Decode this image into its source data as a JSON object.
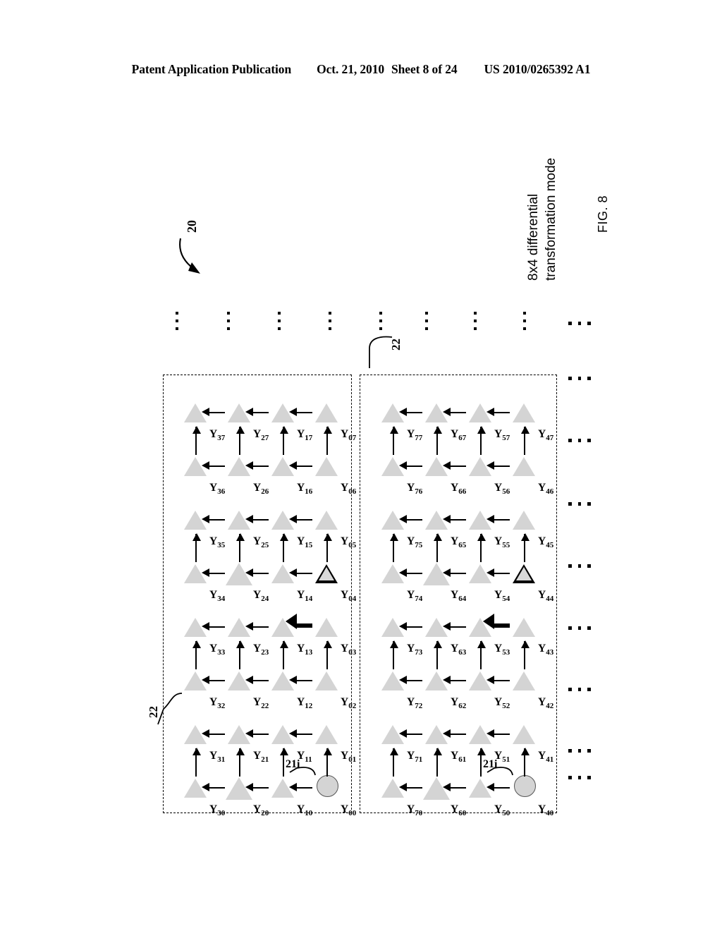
{
  "header": {
    "publication": "Patent Application Publication",
    "date": "Oct. 21, 2010",
    "sheet": "Sheet 8 of 24",
    "number": "US 2010/0265392 A1"
  },
  "figure": {
    "fig_caption": "FIG. 8",
    "mode_caption_line1": "8x4 differential",
    "mode_caption_line2": "transformation mode",
    "ref_20": "20",
    "ref_22_left": "22",
    "ref_22_right": "22",
    "ref_21i_left": "21i",
    "ref_21i_right": "21i",
    "ellipsis_horizontal": "...",
    "groups": [
      {
        "name": "left-group",
        "columns": [
          {
            "nodes": [
              {
                "label": "Y00",
                "sub": "00",
                "shape": "circle",
                "style": "gray"
              },
              {
                "label": "Y01",
                "sub": "01",
                "shape": "triangle",
                "style": "gray"
              },
              {
                "label": "Y02",
                "sub": "02",
                "shape": "triangle",
                "style": "gray"
              },
              {
                "label": "Y03",
                "sub": "03",
                "shape": "triangle",
                "style": "gray"
              },
              {
                "label": "Y04",
                "sub": "04",
                "shape": "triangle",
                "style": "outlined-bold"
              },
              {
                "label": "Y05",
                "sub": "05",
                "shape": "triangle",
                "style": "gray"
              },
              {
                "label": "Y06",
                "sub": "06",
                "shape": "triangle",
                "style": "gray"
              },
              {
                "label": "Y07",
                "sub": "07",
                "shape": "triangle",
                "style": "gray"
              }
            ]
          },
          {
            "nodes": [
              {
                "label": "Y10",
                "sub": "10",
                "shape": "triangle",
                "style": "gray"
              },
              {
                "label": "Y11",
                "sub": "11",
                "shape": "triangle",
                "style": "gray"
              },
              {
                "label": "Y12",
                "sub": "12",
                "shape": "triangle",
                "style": "gray"
              },
              {
                "label": "Y13",
                "sub": "13",
                "shape": "triangle",
                "style": "gray"
              },
              {
                "label": "Y14",
                "sub": "14",
                "shape": "triangle",
                "style": "gray"
              },
              {
                "label": "Y15",
                "sub": "15",
                "shape": "triangle",
                "style": "gray"
              },
              {
                "label": "Y16",
                "sub": "16",
                "shape": "triangle",
                "style": "gray"
              },
              {
                "label": "Y17",
                "sub": "17",
                "shape": "triangle",
                "style": "gray"
              }
            ]
          },
          {
            "nodes": [
              {
                "label": "Y20",
                "sub": "20",
                "shape": "triangle",
                "style": "gray-large"
              },
              {
                "label": "Y21",
                "sub": "21",
                "shape": "triangle",
                "style": "gray"
              },
              {
                "label": "Y22",
                "sub": "22",
                "shape": "triangle",
                "style": "gray"
              },
              {
                "label": "Y23",
                "sub": "23",
                "shape": "triangle",
                "style": "gray"
              },
              {
                "label": "Y24",
                "sub": "24",
                "shape": "triangle",
                "style": "gray-large"
              },
              {
                "label": "Y25",
                "sub": "25",
                "shape": "triangle",
                "style": "gray"
              },
              {
                "label": "Y26",
                "sub": "26",
                "shape": "triangle",
                "style": "gray"
              },
              {
                "label": "Y27",
                "sub": "27",
                "shape": "triangle",
                "style": "gray"
              }
            ]
          },
          {
            "nodes": [
              {
                "label": "Y30",
                "sub": "30",
                "shape": "triangle",
                "style": "gray"
              },
              {
                "label": "Y31",
                "sub": "31",
                "shape": "triangle",
                "style": "gray"
              },
              {
                "label": "Y32",
                "sub": "32",
                "shape": "triangle",
                "style": "gray"
              },
              {
                "label": "Y33",
                "sub": "33",
                "shape": "triangle",
                "style": "gray"
              },
              {
                "label": "Y34",
                "sub": "34",
                "shape": "triangle",
                "style": "gray"
              },
              {
                "label": "Y35",
                "sub": "35",
                "shape": "triangle",
                "style": "gray"
              },
              {
                "label": "Y36",
                "sub": "36",
                "shape": "triangle",
                "style": "gray"
              },
              {
                "label": "Y37",
                "sub": "37",
                "shape": "triangle",
                "style": "gray"
              }
            ]
          }
        ]
      },
      {
        "name": "right-group",
        "columns": [
          {
            "nodes": [
              {
                "label": "Y40",
                "sub": "40",
                "shape": "circle",
                "style": "gray"
              },
              {
                "label": "Y41",
                "sub": "41",
                "shape": "triangle",
                "style": "gray"
              },
              {
                "label": "Y42",
                "sub": "42",
                "shape": "triangle",
                "style": "gray"
              },
              {
                "label": "Y43",
                "sub": "43",
                "shape": "triangle",
                "style": "gray"
              },
              {
                "label": "Y44",
                "sub": "44",
                "shape": "triangle",
                "style": "outlined-bold"
              },
              {
                "label": "Y45",
                "sub": "45",
                "shape": "triangle",
                "style": "gray"
              },
              {
                "label": "Y46",
                "sub": "46",
                "shape": "triangle",
                "style": "gray"
              },
              {
                "label": "Y47",
                "sub": "47",
                "shape": "triangle",
                "style": "gray"
              }
            ]
          },
          {
            "nodes": [
              {
                "label": "Y50",
                "sub": "50",
                "shape": "triangle",
                "style": "gray"
              },
              {
                "label": "Y51",
                "sub": "51",
                "shape": "triangle",
                "style": "gray"
              },
              {
                "label": "Y52",
                "sub": "52",
                "shape": "triangle",
                "style": "gray"
              },
              {
                "label": "Y53",
                "sub": "53",
                "shape": "triangle",
                "style": "gray"
              },
              {
                "label": "Y54",
                "sub": "54",
                "shape": "triangle",
                "style": "gray"
              },
              {
                "label": "Y55",
                "sub": "55",
                "shape": "triangle",
                "style": "gray"
              },
              {
                "label": "Y56",
                "sub": "56",
                "shape": "triangle",
                "style": "gray"
              },
              {
                "label": "Y57",
                "sub": "57",
                "shape": "triangle",
                "style": "gray"
              }
            ]
          },
          {
            "nodes": [
              {
                "label": "Y60",
                "sub": "60",
                "shape": "triangle",
                "style": "gray-large"
              },
              {
                "label": "Y61",
                "sub": "61",
                "shape": "triangle",
                "style": "gray"
              },
              {
                "label": "Y62",
                "sub": "62",
                "shape": "triangle",
                "style": "gray"
              },
              {
                "label": "Y63",
                "sub": "63",
                "shape": "triangle",
                "style": "gray"
              },
              {
                "label": "Y64",
                "sub": "64",
                "shape": "triangle",
                "style": "gray-large"
              },
              {
                "label": "Y65",
                "sub": "65",
                "shape": "triangle",
                "style": "gray"
              },
              {
                "label": "Y66",
                "sub": "66",
                "shape": "triangle",
                "style": "gray"
              },
              {
                "label": "Y67",
                "sub": "67",
                "shape": "triangle",
                "style": "gray"
              }
            ]
          },
          {
            "nodes": [
              {
                "label": "Y70",
                "sub": "70",
                "shape": "triangle",
                "style": "gray"
              },
              {
                "label": "Y71",
                "sub": "71",
                "shape": "triangle",
                "style": "gray"
              },
              {
                "label": "Y72",
                "sub": "72",
                "shape": "triangle",
                "style": "gray"
              },
              {
                "label": "Y73",
                "sub": "73",
                "shape": "triangle",
                "style": "gray"
              },
              {
                "label": "Y74",
                "sub": "74",
                "shape": "triangle",
                "style": "gray"
              },
              {
                "label": "Y75",
                "sub": "75",
                "shape": "triangle",
                "style": "gray"
              },
              {
                "label": "Y76",
                "sub": "76",
                "shape": "triangle",
                "style": "gray"
              },
              {
                "label": "Y77",
                "sub": "77",
                "shape": "triangle",
                "style": "gray"
              }
            ]
          }
        ]
      }
    ],
    "vertical_ellipsis_count": 8,
    "horizontal_ellipsis_count": 9
  }
}
